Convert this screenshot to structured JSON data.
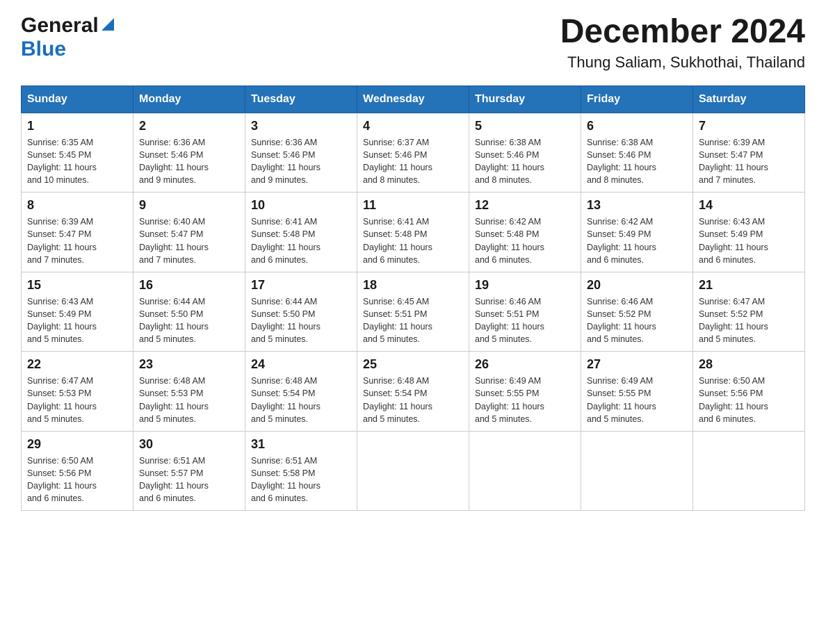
{
  "header": {
    "logo_general": "General",
    "logo_blue": "Blue",
    "main_title": "December 2024",
    "subtitle": "Thung Saliam, Sukhothai, Thailand"
  },
  "weekdays": [
    "Sunday",
    "Monday",
    "Tuesday",
    "Wednesday",
    "Thursday",
    "Friday",
    "Saturday"
  ],
  "weeks": [
    [
      {
        "day": "1",
        "sunrise": "6:35 AM",
        "sunset": "5:45 PM",
        "daylight": "11 hours and 10 minutes."
      },
      {
        "day": "2",
        "sunrise": "6:36 AM",
        "sunset": "5:46 PM",
        "daylight": "11 hours and 9 minutes."
      },
      {
        "day": "3",
        "sunrise": "6:36 AM",
        "sunset": "5:46 PM",
        "daylight": "11 hours and 9 minutes."
      },
      {
        "day": "4",
        "sunrise": "6:37 AM",
        "sunset": "5:46 PM",
        "daylight": "11 hours and 8 minutes."
      },
      {
        "day": "5",
        "sunrise": "6:38 AM",
        "sunset": "5:46 PM",
        "daylight": "11 hours and 8 minutes."
      },
      {
        "day": "6",
        "sunrise": "6:38 AM",
        "sunset": "5:46 PM",
        "daylight": "11 hours and 8 minutes."
      },
      {
        "day": "7",
        "sunrise": "6:39 AM",
        "sunset": "5:47 PM",
        "daylight": "11 hours and 7 minutes."
      }
    ],
    [
      {
        "day": "8",
        "sunrise": "6:39 AM",
        "sunset": "5:47 PM",
        "daylight": "11 hours and 7 minutes."
      },
      {
        "day": "9",
        "sunrise": "6:40 AM",
        "sunset": "5:47 PM",
        "daylight": "11 hours and 7 minutes."
      },
      {
        "day": "10",
        "sunrise": "6:41 AM",
        "sunset": "5:48 PM",
        "daylight": "11 hours and 6 minutes."
      },
      {
        "day": "11",
        "sunrise": "6:41 AM",
        "sunset": "5:48 PM",
        "daylight": "11 hours and 6 minutes."
      },
      {
        "day": "12",
        "sunrise": "6:42 AM",
        "sunset": "5:48 PM",
        "daylight": "11 hours and 6 minutes."
      },
      {
        "day": "13",
        "sunrise": "6:42 AM",
        "sunset": "5:49 PM",
        "daylight": "11 hours and 6 minutes."
      },
      {
        "day": "14",
        "sunrise": "6:43 AM",
        "sunset": "5:49 PM",
        "daylight": "11 hours and 6 minutes."
      }
    ],
    [
      {
        "day": "15",
        "sunrise": "6:43 AM",
        "sunset": "5:49 PM",
        "daylight": "11 hours and 5 minutes."
      },
      {
        "day": "16",
        "sunrise": "6:44 AM",
        "sunset": "5:50 PM",
        "daylight": "11 hours and 5 minutes."
      },
      {
        "day": "17",
        "sunrise": "6:44 AM",
        "sunset": "5:50 PM",
        "daylight": "11 hours and 5 minutes."
      },
      {
        "day": "18",
        "sunrise": "6:45 AM",
        "sunset": "5:51 PM",
        "daylight": "11 hours and 5 minutes."
      },
      {
        "day": "19",
        "sunrise": "6:46 AM",
        "sunset": "5:51 PM",
        "daylight": "11 hours and 5 minutes."
      },
      {
        "day": "20",
        "sunrise": "6:46 AM",
        "sunset": "5:52 PM",
        "daylight": "11 hours and 5 minutes."
      },
      {
        "day": "21",
        "sunrise": "6:47 AM",
        "sunset": "5:52 PM",
        "daylight": "11 hours and 5 minutes."
      }
    ],
    [
      {
        "day": "22",
        "sunrise": "6:47 AM",
        "sunset": "5:53 PM",
        "daylight": "11 hours and 5 minutes."
      },
      {
        "day": "23",
        "sunrise": "6:48 AM",
        "sunset": "5:53 PM",
        "daylight": "11 hours and 5 minutes."
      },
      {
        "day": "24",
        "sunrise": "6:48 AM",
        "sunset": "5:54 PM",
        "daylight": "11 hours and 5 minutes."
      },
      {
        "day": "25",
        "sunrise": "6:48 AM",
        "sunset": "5:54 PM",
        "daylight": "11 hours and 5 minutes."
      },
      {
        "day": "26",
        "sunrise": "6:49 AM",
        "sunset": "5:55 PM",
        "daylight": "11 hours and 5 minutes."
      },
      {
        "day": "27",
        "sunrise": "6:49 AM",
        "sunset": "5:55 PM",
        "daylight": "11 hours and 5 minutes."
      },
      {
        "day": "28",
        "sunrise": "6:50 AM",
        "sunset": "5:56 PM",
        "daylight": "11 hours and 6 minutes."
      }
    ],
    [
      {
        "day": "29",
        "sunrise": "6:50 AM",
        "sunset": "5:56 PM",
        "daylight": "11 hours and 6 minutes."
      },
      {
        "day": "30",
        "sunrise": "6:51 AM",
        "sunset": "5:57 PM",
        "daylight": "11 hours and 6 minutes."
      },
      {
        "day": "31",
        "sunrise": "6:51 AM",
        "sunset": "5:58 PM",
        "daylight": "11 hours and 6 minutes."
      },
      null,
      null,
      null,
      null
    ]
  ],
  "labels": {
    "sunrise_prefix": "Sunrise: ",
    "sunset_prefix": "Sunset: ",
    "daylight_prefix": "Daylight: "
  }
}
